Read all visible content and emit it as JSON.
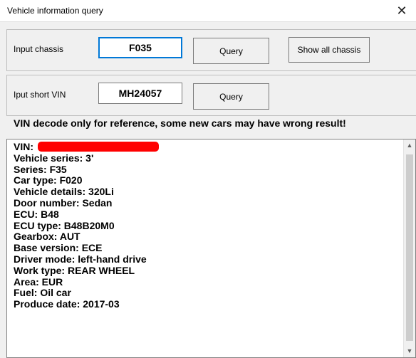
{
  "window": {
    "title": "Vehicle information query",
    "close_glyph": "✕"
  },
  "chassis": {
    "label": "Input chassis",
    "value": "F035",
    "query_label": "Query",
    "show_all_label": "Show all chassis"
  },
  "vin": {
    "label": "Iput short VIN",
    "value": "MH24057",
    "query_label": "Query"
  },
  "notice": "VIN decode only for reference, some new cars may have wrong result!",
  "output": {
    "vin_label": "VIN:",
    "lines": [
      "Vehicle series: 3'",
      "Series: F35",
      "Car type: F020",
      "Vehicle details: 320Li",
      "Door number: Sedan",
      "ECU: B48",
      "ECU type: B48B20M0",
      "Gearbox: AUT",
      "Base version: ECE",
      "Driver mode: left-hand drive",
      "Work type: REAR WHEEL",
      "Area: EUR",
      "Fuel: Oil car",
      "Produce date: 2017-03"
    ]
  },
  "scrollbar": {
    "up_glyph": "▲",
    "down_glyph": "▼"
  },
  "colors": {
    "redaction": "#ff0000",
    "focus_border": "#0078d7"
  },
  "icons": {
    "close": "close-icon"
  }
}
